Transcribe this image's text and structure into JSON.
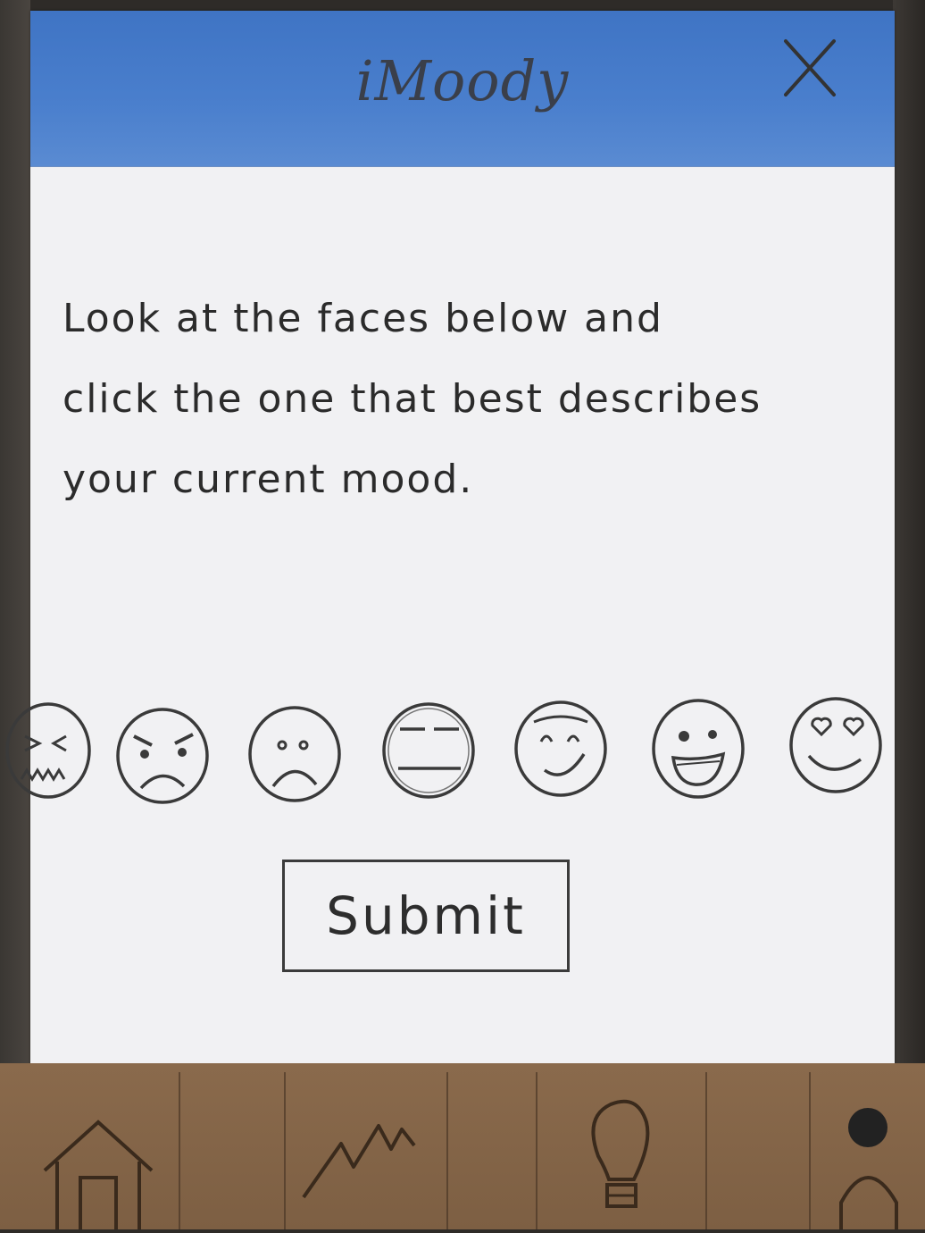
{
  "app": {
    "title": "iMoody"
  },
  "instructions": {
    "lines": [
      "Look at the faces below and",
      "click the one that best describes",
      "your current mood."
    ]
  },
  "moods": [
    {
      "icon": "frustrated-face-icon"
    },
    {
      "icon": "angry-face-icon"
    },
    {
      "icon": "sad-face-icon"
    },
    {
      "icon": "neutral-face-icon"
    },
    {
      "icon": "content-face-icon"
    },
    {
      "icon": "happy-face-icon"
    },
    {
      "icon": "love-face-icon"
    }
  ],
  "actions": {
    "submit_label": "Submit"
  },
  "tab_bar": {
    "tabs": [
      {
        "icon": "home-icon"
      },
      {
        "icon": "trend-chart-icon"
      },
      {
        "icon": "lightbulb-icon"
      },
      {
        "icon": "profile-icon"
      }
    ]
  },
  "colors": {
    "header": "#4a7fcd",
    "paper": "#f1f1f3",
    "ink": "#2b2b2b",
    "tab_bar": "#8a6a4c"
  }
}
